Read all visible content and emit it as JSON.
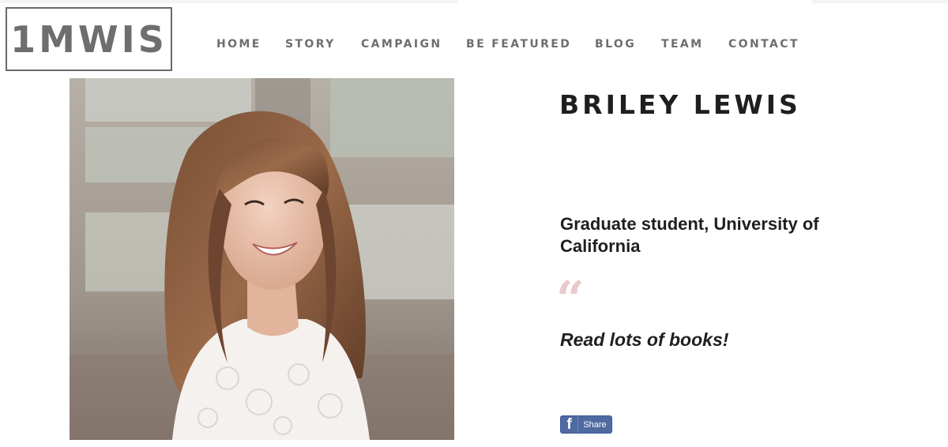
{
  "brand": {
    "logo_text": "1MWIS"
  },
  "nav": {
    "items": [
      "HOME",
      "STORY",
      "CAMPAIGN",
      "BE FEATURED",
      "BLOG",
      "TEAM",
      "CONTACT"
    ]
  },
  "profile": {
    "name": "BRILEY LEWIS",
    "role": "Graduate student, University of California",
    "quote_mark": "“",
    "quote": "Read lots of books!"
  },
  "share": {
    "label": "Share",
    "icon": "facebook-icon",
    "icon_glyph": "f"
  },
  "colors": {
    "nav_text": "#6e6e6e",
    "heading_text": "#1f1f1f",
    "quote_mark": "#e9c9cc",
    "facebook_blue": "#4f6aa0"
  }
}
